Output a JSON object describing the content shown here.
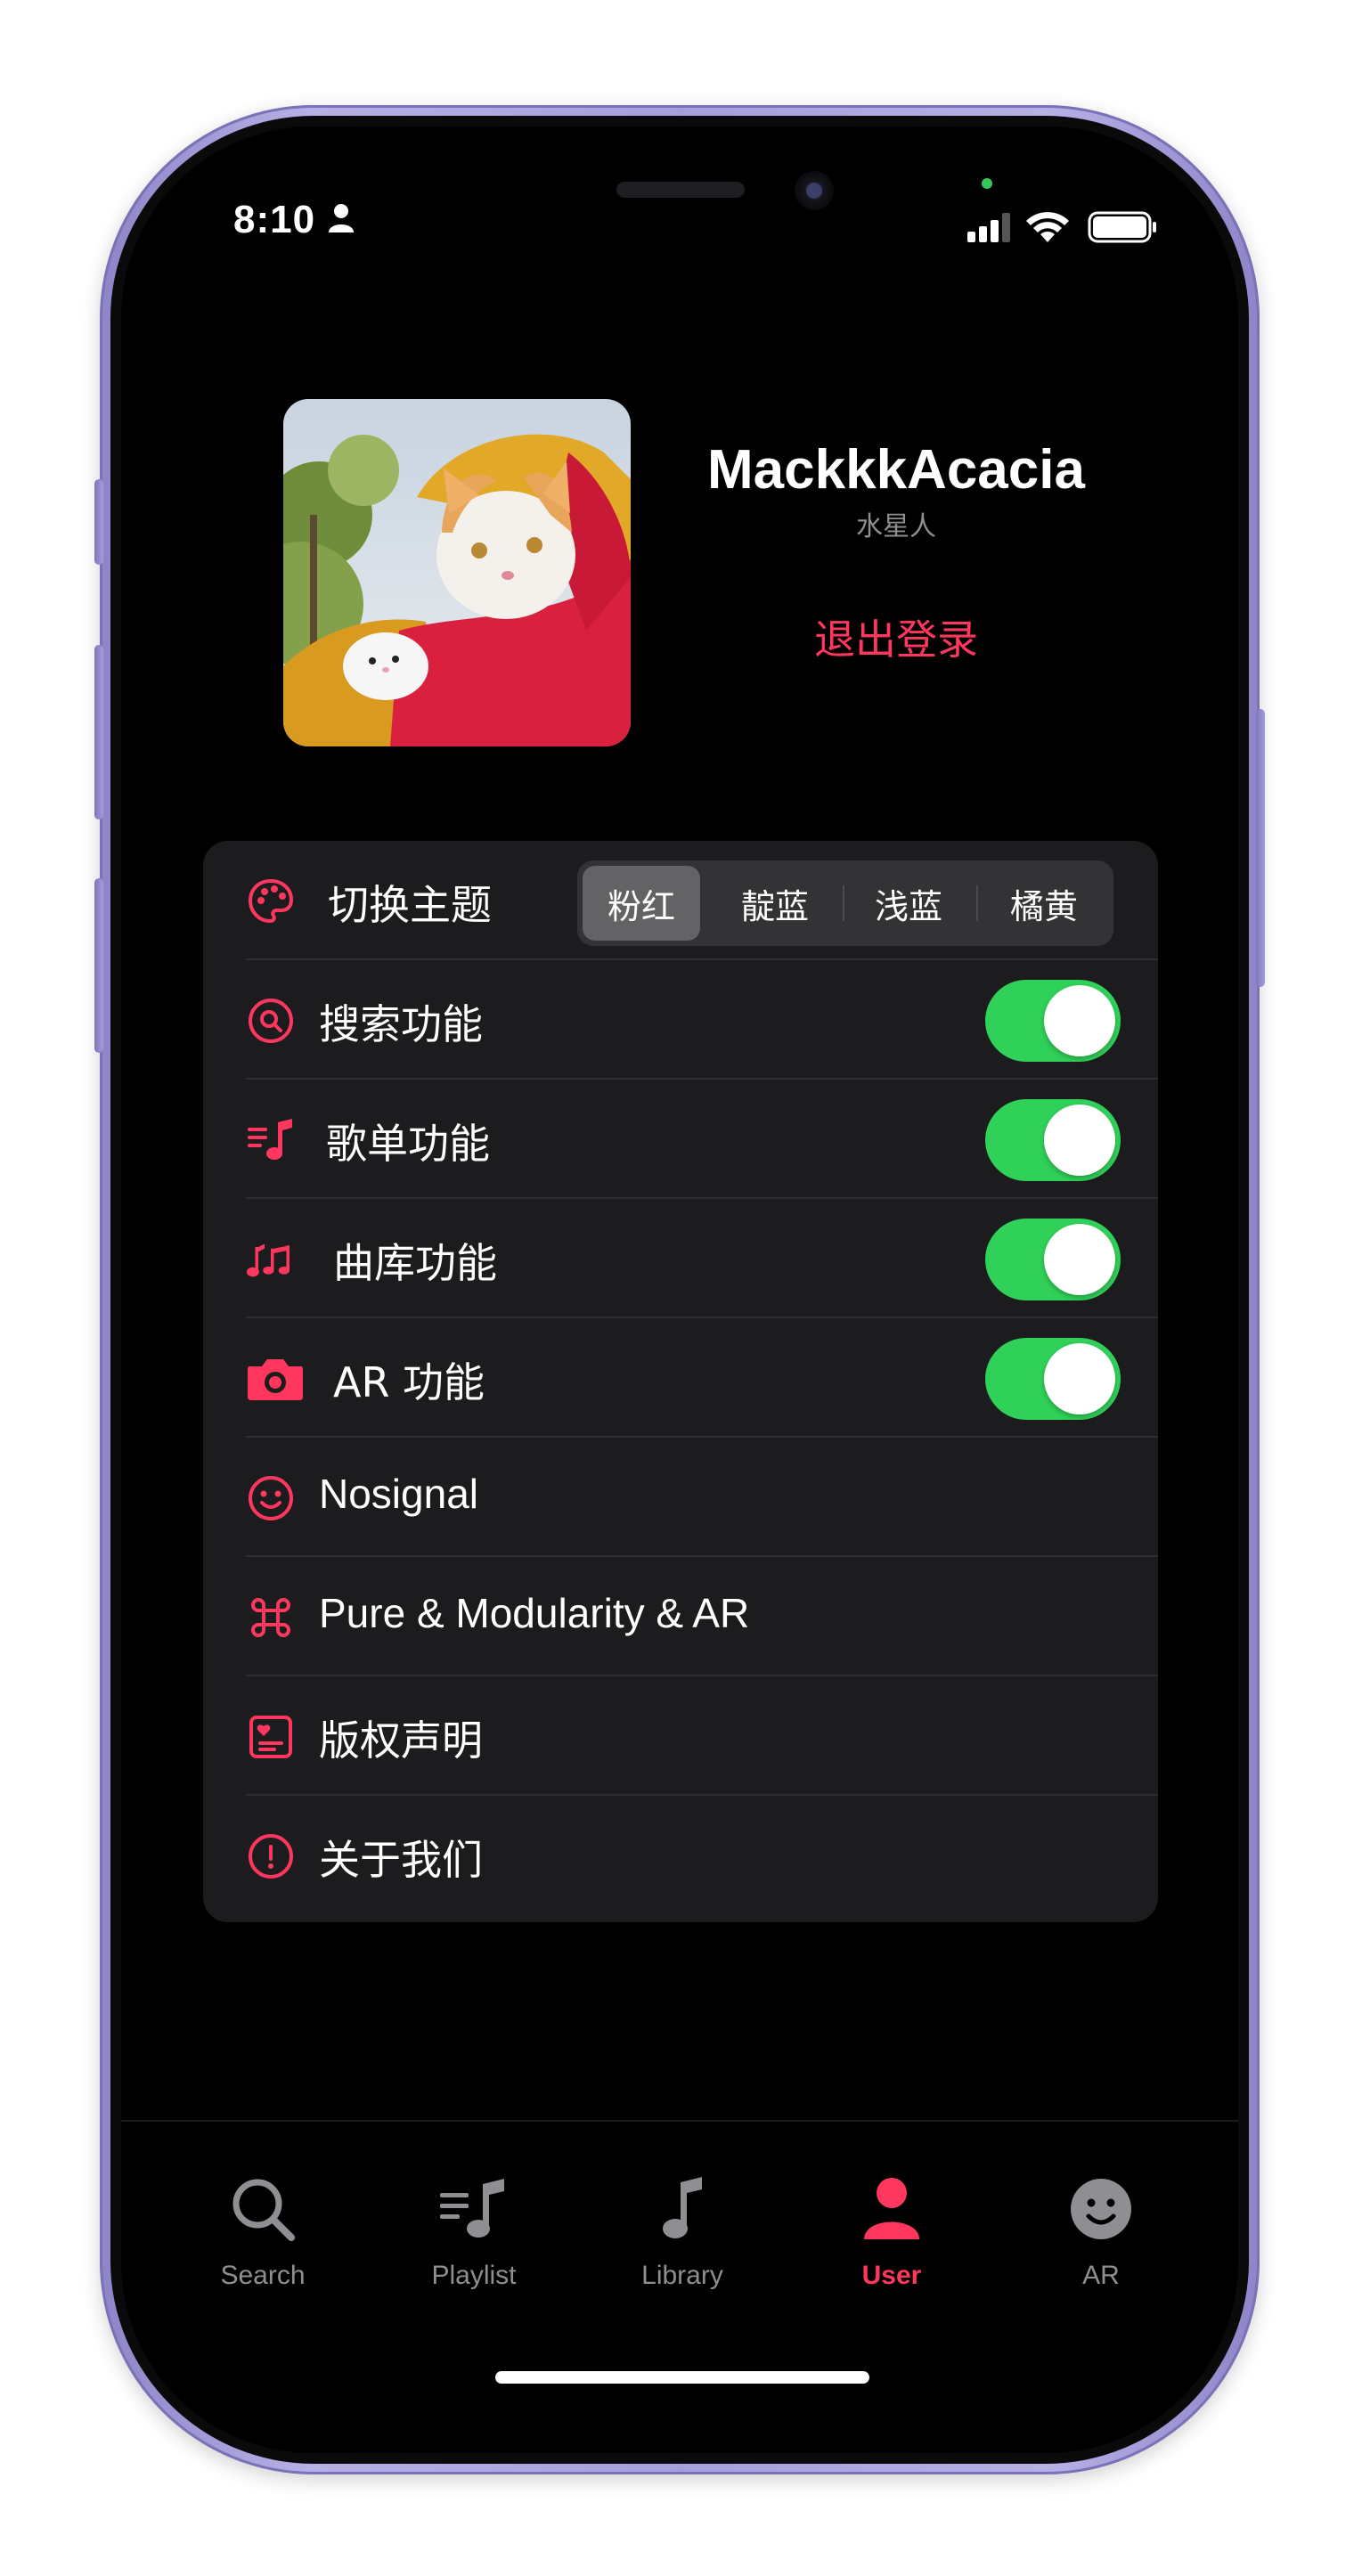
{
  "status_bar": {
    "time": "8:10"
  },
  "profile": {
    "name": "MackkkAcacia",
    "subtitle": "水星人",
    "logout_label": "退出登录"
  },
  "settings": {
    "theme": {
      "label": "切换主题",
      "icon": "palette-icon",
      "options": [
        "粉红",
        "靛蓝",
        "浅蓝",
        "橘黄"
      ],
      "selected": "粉红"
    },
    "toggles": [
      {
        "label": "搜索功能",
        "icon": "search-circle-icon",
        "on": true
      },
      {
        "label": "歌单功能",
        "icon": "music-list-icon",
        "on": true
      },
      {
        "label": "曲库功能",
        "icon": "music-notes-icon",
        "on": true
      },
      {
        "label": "AR 功能",
        "icon": "camera-icon",
        "on": true
      }
    ],
    "links": [
      {
        "label": "Nosignal",
        "icon": "smiley-icon"
      },
      {
        "label": "Pure & Modularity & AR",
        "icon": "command-icon"
      },
      {
        "label": "版权声明",
        "icon": "license-card-icon"
      },
      {
        "label": "关于我们",
        "icon": "exclamation-circle-icon"
      }
    ]
  },
  "tab_bar": {
    "tabs": [
      {
        "label": "Search",
        "icon": "magnifier-icon"
      },
      {
        "label": "Playlist",
        "icon": "playlist-icon"
      },
      {
        "label": "Library",
        "icon": "music-note-icon"
      },
      {
        "label": "User",
        "icon": "person-icon"
      },
      {
        "label": "AR",
        "icon": "face-icon"
      }
    ],
    "active": "User"
  },
  "colors": {
    "accent": "#ff375f",
    "toggle_on": "#30d158",
    "card_bg": "#1c1c1e",
    "inactive": "#8e8e93",
    "phone_frame": "#a79fdc"
  }
}
